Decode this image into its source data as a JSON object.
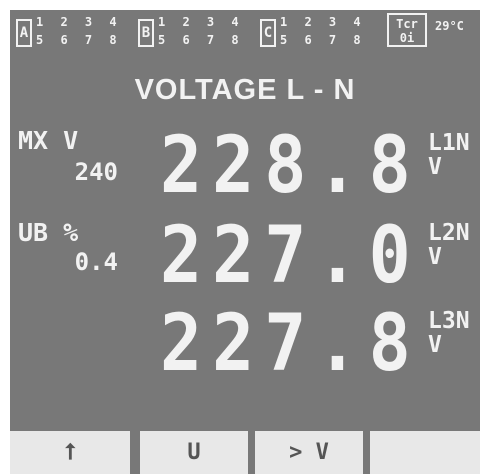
{
  "status_bar": {
    "groups": [
      {
        "letter": "A",
        "top": "1 2 3 4",
        "bottom": "5 6 7 8"
      },
      {
        "letter": "B",
        "top": "1 2 3 4",
        "bottom": "5 6 7 8"
      },
      {
        "letter": "C",
        "top": "1 2 3 4",
        "bottom": "5 6 7 8"
      }
    ],
    "tcr_top": "Tcr",
    "tcr_bottom": "0i",
    "temperature": "29°C"
  },
  "title": "VOLTAGE L - N",
  "side": {
    "max_label": "MX V",
    "max_value": "240",
    "unb_label": "UB %",
    "unb_value": "0.4"
  },
  "readings": [
    {
      "value": "228.8",
      "phase": "L1N",
      "unit": "V"
    },
    {
      "value": "227.0",
      "phase": "L2N",
      "unit": "V"
    },
    {
      "value": "227.8",
      "phase": "L3N",
      "unit": "V"
    }
  ],
  "softkeys": [
    "⭡",
    "U",
    "> V",
    ""
  ],
  "colors": {
    "screen": "#787878",
    "text": "#f2f2f2",
    "softkey_bg": "#e8e8e8"
  }
}
